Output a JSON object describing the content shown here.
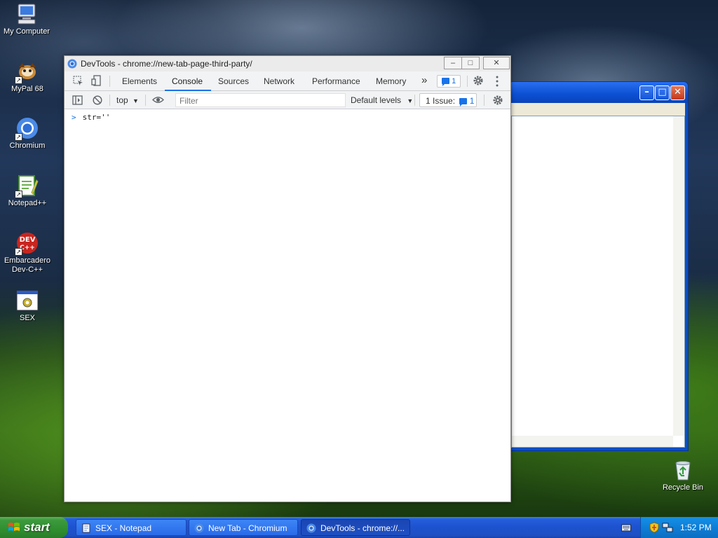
{
  "desktop": {
    "icons": [
      {
        "label": "My Computer",
        "icon": "my-computer-icon"
      },
      {
        "label": "MyPal 68",
        "icon": "mypal-icon"
      },
      {
        "label": "Chromium",
        "icon": "chromium-icon"
      },
      {
        "label": "Notepad++",
        "icon": "notepadpp-icon"
      },
      {
        "label": "Embarcadero Dev-C++",
        "icon": "devcpp-icon",
        "icon_text": "DEV C++"
      },
      {
        "label": "SEX",
        "icon": "exe-icon"
      }
    ],
    "recycle_bin": {
      "label": "Recycle Bin",
      "icon": "recycle-bin-icon"
    }
  },
  "devtools": {
    "title": "DevTools - chrome://new-tab-page-third-party/",
    "window_controls": {
      "minimize": "–",
      "maximize": "□",
      "close": "✕"
    },
    "tabs": [
      {
        "label": "Elements",
        "active": false
      },
      {
        "label": "Console",
        "active": true
      },
      {
        "label": "Sources",
        "active": false
      },
      {
        "label": "Network",
        "active": false
      },
      {
        "label": "Performance",
        "active": false
      },
      {
        "label": "Memory",
        "active": false
      }
    ],
    "more_tabs": "»",
    "issues_badge_count": "1",
    "toolbar": {
      "context": "top",
      "filter_placeholder": "Filter",
      "levels": "Default levels",
      "issues_label": "1 Issue:",
      "issues_count": "1"
    },
    "console": {
      "prompt": ">",
      "input": "str=''"
    }
  },
  "notepad_window": {
    "minimize": "–",
    "maximize": "□",
    "close": "✕"
  },
  "taskbar": {
    "start_label": "start",
    "buttons": [
      {
        "label": "SEX - Notepad",
        "active": false
      },
      {
        "label": "New Tab - Chromium",
        "active": false
      },
      {
        "label": "DevTools - chrome://...",
        "active": true
      }
    ],
    "clock": "1:52 PM"
  },
  "colors": {
    "accent": "#1a73e8",
    "taskbar": "#245edb",
    "start_green": "#3c9a3c"
  }
}
